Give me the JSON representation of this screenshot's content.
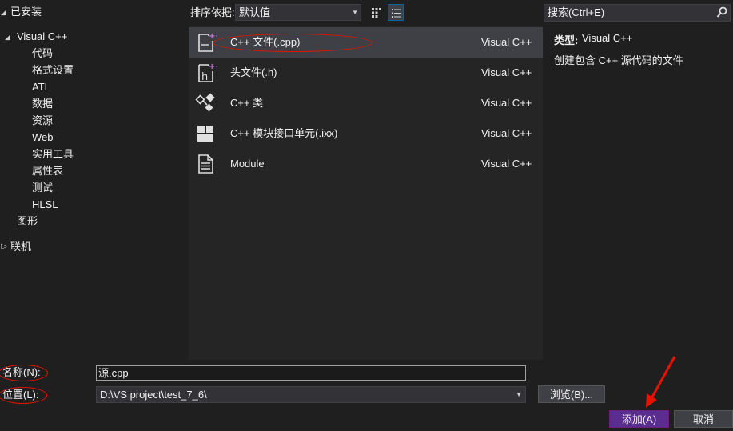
{
  "tree": {
    "installed": "已安装",
    "visual_cpp": "Visual C++",
    "children": [
      "代码",
      "格式设置",
      "ATL",
      "数据",
      "资源",
      "Web",
      "实用工具",
      "属性表",
      "测试",
      "HLSL"
    ],
    "graphics": "图形",
    "online": "联机"
  },
  "toolbar": {
    "sort_label": "排序依据:",
    "sort_value": "默认值"
  },
  "templates": [
    {
      "name": "C++ 文件(.cpp)",
      "lang": "Visual C++",
      "icon": "cpp-file-icon"
    },
    {
      "name": "头文件(.h)",
      "lang": "Visual C++",
      "icon": "header-file-icon"
    },
    {
      "name": "C++ 类",
      "lang": "Visual C++",
      "icon": "cpp-class-icon"
    },
    {
      "name": "C++ 模块接口单元(.ixx)",
      "lang": "Visual C++",
      "icon": "module-interface-icon"
    },
    {
      "name": "Module",
      "lang": "Visual C++",
      "icon": "module-icon"
    }
  ],
  "search": {
    "placeholder": "搜索(Ctrl+E)"
  },
  "details": {
    "type_label": "类型:",
    "type_value": "Visual C++",
    "description": "创建包含 C++ 源代码的文件"
  },
  "form": {
    "name_label": "名称(N):",
    "name_value": "源.cpp",
    "location_label": "位置(L):",
    "location_value": "D:\\VS project\\test_7_6\\",
    "browse": "浏览(B)...",
    "add": "添加(A)",
    "cancel": "取消"
  },
  "colors": {
    "accent": "#5c2d91",
    "annotation": "#e51400",
    "selection": "#3f3f46"
  }
}
